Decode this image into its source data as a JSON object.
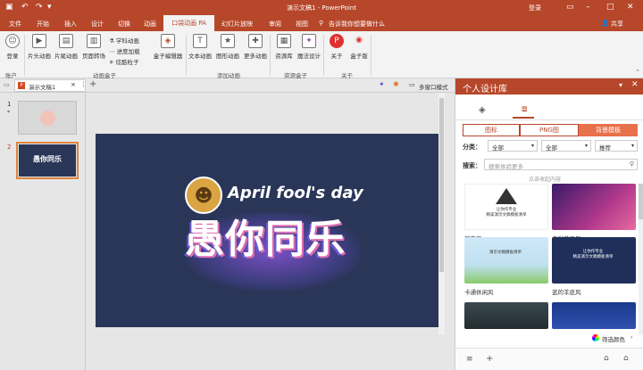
{
  "titlebar": {
    "title": "演示文稿1  -  PowerPoint",
    "login": "登录"
  },
  "tabs": [
    "文件",
    "开始",
    "插入",
    "设计",
    "切换",
    "动画",
    "口袋动画 PA",
    "幻灯片放映",
    "审阅",
    "视图"
  ],
  "active_tab": "口袋动画 PA",
  "search_hint": "告诉我你想要做什么",
  "share": "共享",
  "ribbon": {
    "account": "登录",
    "account_group": "账户",
    "buttons": [
      "片头动画",
      "片尾动画",
      "页面转场",
      "盒子编辑器",
      "文本动画",
      "图形动画",
      "更多动画",
      "资源库",
      "魔法设计",
      "关于",
      "盒子版"
    ],
    "small": [
      "学科动画",
      "进度加载",
      "炫酷粒子"
    ],
    "groups": [
      "动画盒子",
      "添加动画",
      "资源盒子",
      "关于"
    ]
  },
  "doctab": {
    "name": "演示文稿1",
    "mode": "多窗口模式"
  },
  "thumbs": [
    {
      "num": "1",
      "star": "*"
    },
    {
      "num": "2"
    }
  ],
  "slide": {
    "title_en": "April fool's day",
    "title_cn": "愚你同乐"
  },
  "panel": {
    "title": "个人设计库",
    "subtabs": [
      "图标",
      "PNG图",
      "背景模板"
    ],
    "category_label": "分类：",
    "category_value": "全部",
    "category2_value": "全部",
    "sort_value": "推荐",
    "search_label": "搜索：",
    "search_placeholder": "搜索体验更多",
    "collapse": "点击收起内容",
    "cards": [
      {
        "caption": "朋克风",
        "inner": "让你作专业\n精美演示文稿模板清单"
      },
      {
        "caption": "多彩苹果风",
        "inner": ""
      },
      {
        "caption": "卡通休闲风",
        "inner": "演示文稿模板清单"
      },
      {
        "caption": "蓝的羊皮风",
        "inner": "让你作专业\n精美演示文稿模板清单"
      },
      {
        "caption": "",
        "inner": ""
      },
      {
        "caption": "",
        "inner": ""
      }
    ],
    "filter_color": "筛选颜色"
  },
  "colors": {
    "accent": "#b7472a",
    "slide_bg": "#2a3658"
  }
}
